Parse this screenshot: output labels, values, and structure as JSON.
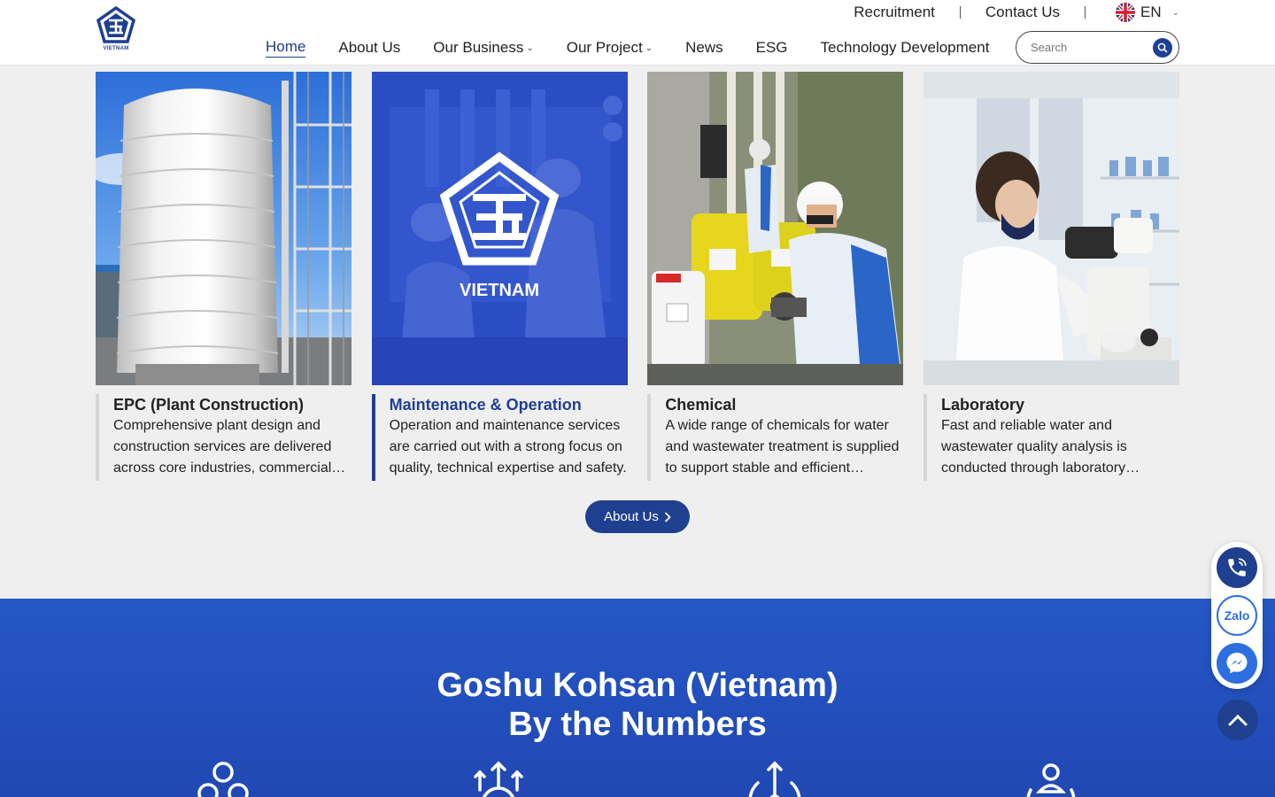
{
  "brand": {
    "logo_text": "VIETNAM",
    "primary_color": "#1f3f8f",
    "accent_blue": "#2557c7"
  },
  "topbar": {
    "recruitment": "Recruitment",
    "contact": "Contact Us",
    "language": "EN"
  },
  "nav": {
    "items": [
      {
        "label": "Home",
        "active": true
      },
      {
        "label": "About Us"
      },
      {
        "label": "Our Business",
        "has_dropdown": true
      },
      {
        "label": "Our Project",
        "has_dropdown": true
      },
      {
        "label": "News"
      },
      {
        "label": "ESG"
      },
      {
        "label": "Technology Development"
      }
    ]
  },
  "search": {
    "placeholder": "Search"
  },
  "cards": [
    {
      "title": "EPC (Plant Construction)",
      "description": "Comprehensive plant design and construction services are delivered across core industries, commercial and industrial facilities."
    },
    {
      "title": "Maintenance & Operation",
      "description": "Operation and maintenance services are carried out with a strong focus on quality, technical expertise and safety.",
      "overlay_text": "VIETNAM",
      "active": true
    },
    {
      "title": "Chemical",
      "description": "A wide range of chemicals for water and wastewater treatment is supplied to support stable and efficient operation."
    },
    {
      "title": "Laboratory",
      "description": "Fast and reliable water and wastewater quality analysis is conducted through laboratory services."
    }
  ],
  "about_button": {
    "label": "About Us"
  },
  "numbers": {
    "title_line1": "Goshu Kohsan (Vietnam)",
    "title_line2": "By the Numbers"
  },
  "floating": {
    "zalo_label": "Zalo"
  },
  "icons": [
    "phone-icon",
    "zalo-icon",
    "messenger-icon",
    "chevron-up-icon",
    "search-icon",
    "uk-flag-icon"
  ]
}
